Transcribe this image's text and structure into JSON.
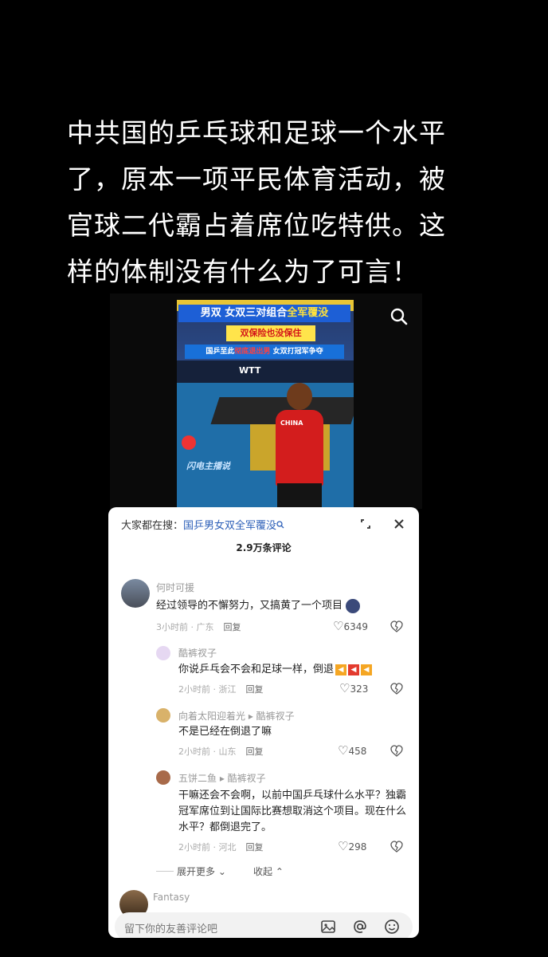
{
  "headline": "中共国的乒乓球和足球一个水平了，原本一项平民体育活动，被官球二代霸占着席位吃特供。这样的体制没有什么为了可言！",
  "video": {
    "banner_main_white": "男双 女双三对组合",
    "banner_main_yellow": "全军覆没",
    "banner_sub": "双保险也没保住",
    "banner_third_a": "国乒至此",
    "banner_third_red": "彻底退出男",
    "banner_third_b": " 女双打冠军争夺",
    "board_text": "WTT",
    "jersey": "CHINA",
    "watermark": "闪电主播说"
  },
  "comments_sheet": {
    "hot_label": "大家都在搜：",
    "hot_query": "国乒男女双全军覆没",
    "count": "2.9万条评论",
    "expand_label": "展开更多",
    "collapse_label": "收起",
    "input_placeholder": "留下你的友善评论吧",
    "comments": [
      {
        "user": "何时可援",
        "text": "经过领导的不懈努力，又搞黄了一个项目",
        "time": "3小时前",
        "loc": "广东",
        "reply": "回复",
        "likes": "6349"
      },
      {
        "user": "酷裤衩子",
        "text": "你说乒乓会不会和足球一样，倒退",
        "time": "2小时前",
        "loc": "浙江",
        "reply": "回复",
        "likes": "323"
      },
      {
        "user": "向着太阳迎着光",
        "reply_to": "酷裤衩子",
        "text": "不是已经在倒退了嘛",
        "time": "2小时前",
        "loc": "山东",
        "reply": "回复",
        "likes": "458"
      },
      {
        "user": "五饼二鱼",
        "reply_to": "酷裤衩子",
        "text": "干嘛还会不会啊，以前中国乒乓球什么水平？独霸冠军席位到让国际比赛想取消这个项目。现在什么水平？都倒退完了。",
        "time": "2小时前",
        "loc": "河北",
        "reply": "回复",
        "likes": "298"
      },
      {
        "user": "Fantasy"
      }
    ]
  }
}
